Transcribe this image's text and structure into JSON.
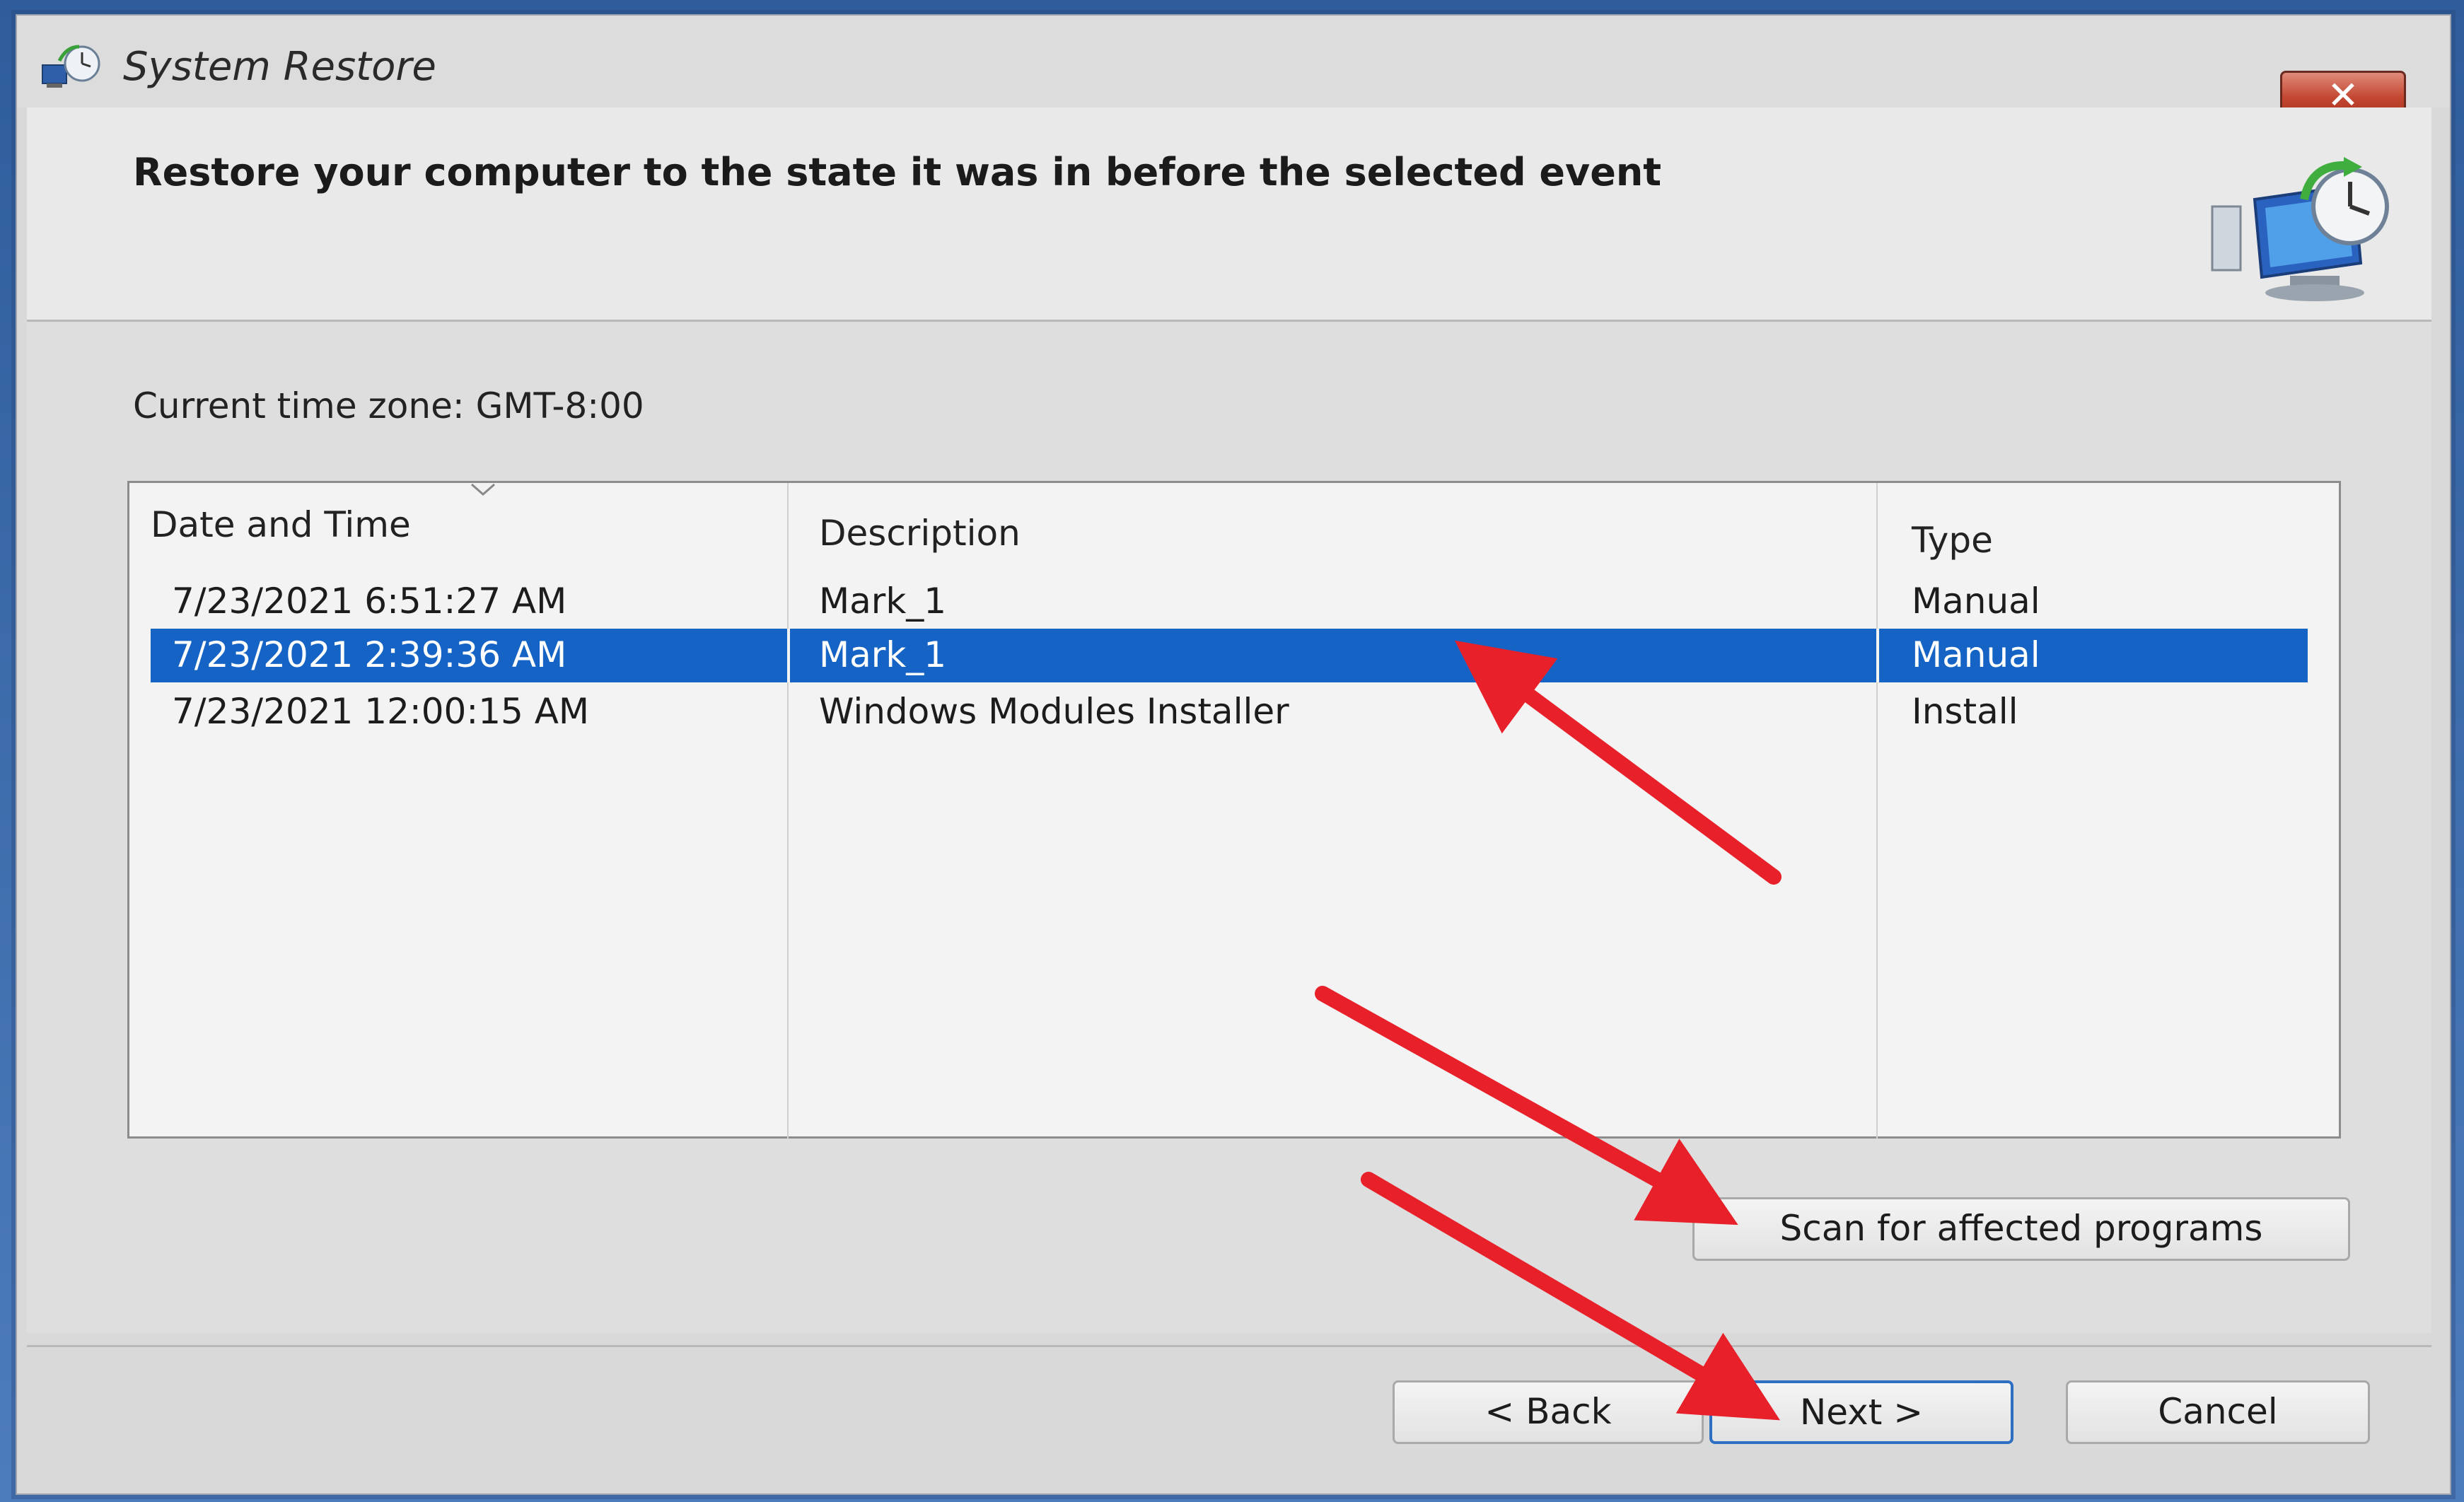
{
  "window": {
    "title": "System Restore",
    "close_label": "✕"
  },
  "header": {
    "heading": "Restore your computer to the state it was in before the selected event"
  },
  "content": {
    "timezone": "Current time zone: GMT-8:00",
    "list": {
      "columns": [
        "Date and Time",
        "Description",
        "Type"
      ],
      "rows": [
        {
          "date": "7/23/2021 6:51:27 AM",
          "description": "Mark_1",
          "type": "Manual",
          "selected": false
        },
        {
          "date": "7/23/2021 2:39:36 AM",
          "description": "Mark_1",
          "type": "Manual",
          "selected": true
        },
        {
          "date": "7/23/2021 12:00:15 AM",
          "description": "Windows Modules Installer",
          "type": "Install",
          "selected": false
        }
      ]
    },
    "scan_button": "Scan for affected programs"
  },
  "footer": {
    "back_label": "< Back",
    "next_label": "Next >",
    "cancel_label": "Cancel"
  },
  "colors": {
    "selection": "#1563c4",
    "annotation_arrow": "#e8202a",
    "close_button": "#c2452f"
  },
  "icons": {
    "title": "system-restore-icon",
    "header": "restore-computer-clock-icon"
  }
}
